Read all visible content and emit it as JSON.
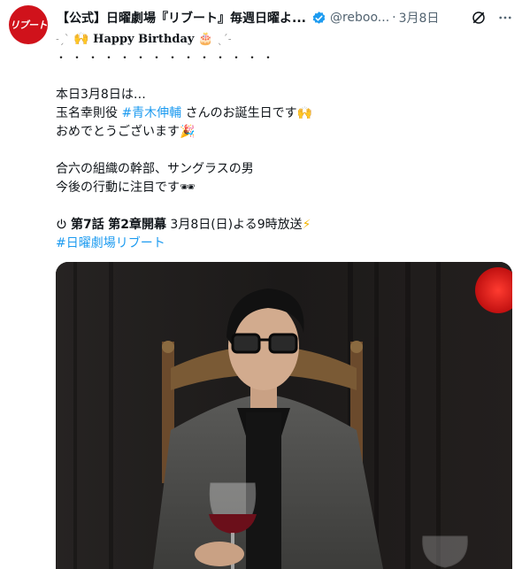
{
  "post": {
    "author_name": "【公式】日曜劇場『リブート』毎週日曜よ...",
    "handle": "@reboo...",
    "date": "3月8日",
    "avatar_text": "リブート",
    "icons": {
      "verified": "verified-badge-icon",
      "grok": "grok-icon",
      "more": "more-icon"
    },
    "colors": {
      "link": "#1d9bf0",
      "verified": "#1d9bf0",
      "avatar_bg": "#d0121b"
    }
  },
  "content": {
    "bday_text": "Happy Birthday",
    "dots": "・・・・・・・・・・・・・・",
    "l1": "本日3月8日は…",
    "l2_pre": "玉名幸則役",
    "l2_tag": "#青木伸輔",
    "l2_post": "さんのお誕生日です",
    "l3": "おめでとうございます",
    "l4": "合六の組織の幹部、サングラスの男",
    "l5": "今後の行動に注目です",
    "l6_a": "第7話",
    "l6_b": "第2章開幕",
    "l6_c": "3月8日(日)よる9時放送",
    "hashtag": "#日曜劇場リブート"
  }
}
